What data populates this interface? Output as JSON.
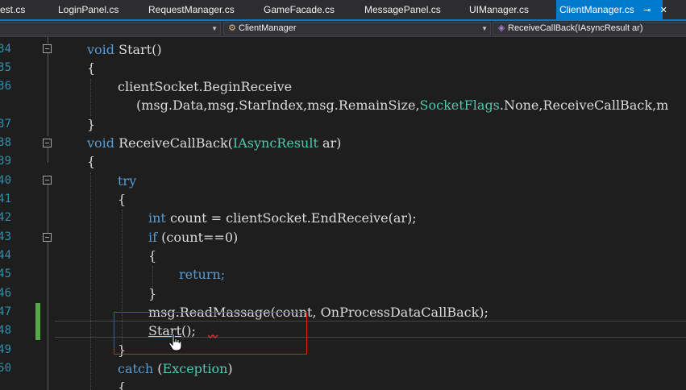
{
  "tabs": [
    {
      "label": "est.cs",
      "active": false
    },
    {
      "label": "LoginPanel.cs",
      "active": false
    },
    {
      "label": "RequestManager.cs",
      "active": false
    },
    {
      "label": "GameFacade.cs",
      "active": false
    },
    {
      "label": "MessagePanel.cs",
      "active": false
    },
    {
      "label": "UIManager.cs",
      "active": false
    },
    {
      "label": "ClientManager.cs",
      "active": true
    }
  ],
  "active_tab_pin_glyph": "⊸",
  "active_tab_close_glyph": "✕",
  "navbar": {
    "class_dropdown": "ClientManager",
    "member_dropdown": "ReceiveCallBack(IAsyncResult ar)",
    "class_icon": "class-icon",
    "member_icon": "method-icon"
  },
  "line_numbers": [
    "34",
    "35",
    "36",
    "",
    "37",
    "38",
    "39",
    "40",
    "41",
    "42",
    "43",
    "44",
    "45",
    "46",
    "47",
    "48",
    "49",
    "50",
    ""
  ],
  "code": {
    "l34_kw": "void",
    "l34_rest": " Start()",
    "l35": "{",
    "l36": "clientSocket.BeginReceive",
    "l36b_a": "(msg.Data,msg.StarIndex,msg.RemainSize,",
    "l36b_type": "SocketFlags",
    "l36b_b": ".None,ReceiveCallBack,m",
    "l37": "}",
    "l38_kw": "void",
    "l38_mid": " ReceiveCallBack(",
    "l38_type": "IAsyncResult",
    "l38_end": " ar)",
    "l39": "{",
    "l40": "try",
    "l41": "{",
    "l42_kw": "int",
    "l42_rest": " count = clientSocket.EndReceive(ar);",
    "l43_kw": "if",
    "l43_rest": " (count==0)",
    "l44": "{",
    "l45": "return;",
    "l46": "}",
    "l47": "msg.ReadMassage(count, OnProcessDataCallBack);",
    "l48_link": "Start",
    "l48_rest": "();",
    "l49": "}",
    "l50_kw": "catch",
    "l50_mid": " (",
    "l50_type": "Exception",
    "l50_end": ")",
    "l51": "{"
  },
  "colors": {
    "keyword": "#569cd6",
    "type": "#4ec9b0",
    "line_number": "#2b91af",
    "accent": "#007acc",
    "highlight_box": "#e02020"
  }
}
